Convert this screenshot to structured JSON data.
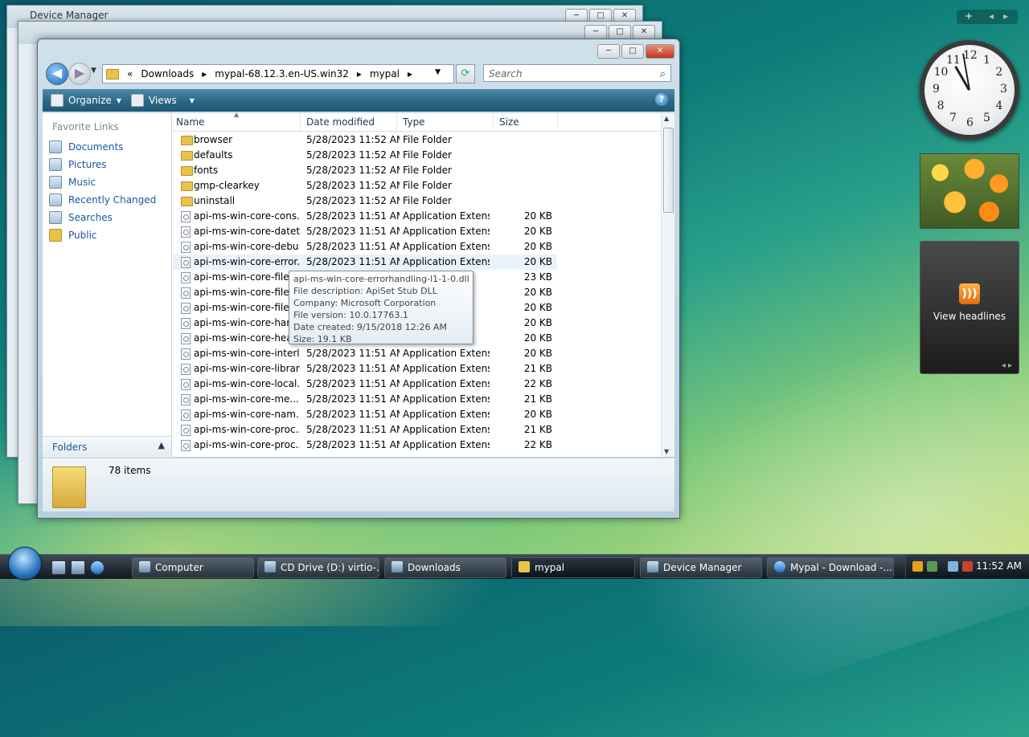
{
  "background_windows": [
    {
      "title": "Device Manager"
    },
    {
      "title": ""
    }
  ],
  "window_controls": {
    "minimize": "─",
    "maximize": "□",
    "close": "✕"
  },
  "address": {
    "prefix": "«",
    "crumbs": [
      "Downloads",
      "mypal-68.12.3.en-US.win32",
      "mypal"
    ],
    "separator": "▸",
    "search_placeholder": "Search"
  },
  "toolbar": {
    "organize": "Organize",
    "views": "Views",
    "help": "?"
  },
  "nav": {
    "heading": "Favorite Links",
    "items": [
      "Documents",
      "Pictures",
      "Music",
      "Recently Changed",
      "Searches",
      "Public"
    ],
    "folders_label": "Folders"
  },
  "columns": {
    "name": "Name",
    "date": "Date modified",
    "type": "Type",
    "size": "Size"
  },
  "files": [
    {
      "name": "browser",
      "date": "5/28/2023 11:52 AM",
      "type": "File Folder",
      "size": "",
      "kind": "folder"
    },
    {
      "name": "defaults",
      "date": "5/28/2023 11:52 AM",
      "type": "File Folder",
      "size": "",
      "kind": "folder"
    },
    {
      "name": "fonts",
      "date": "5/28/2023 11:52 AM",
      "type": "File Folder",
      "size": "",
      "kind": "folder"
    },
    {
      "name": "gmp-clearkey",
      "date": "5/28/2023 11:52 AM",
      "type": "File Folder",
      "size": "",
      "kind": "folder"
    },
    {
      "name": "uninstall",
      "date": "5/28/2023 11:52 AM",
      "type": "File Folder",
      "size": "",
      "kind": "folder"
    },
    {
      "name": "api-ms-win-core-cons...",
      "date": "5/28/2023 11:51 AM",
      "type": "Application Extens...",
      "size": "20 KB",
      "kind": "dll"
    },
    {
      "name": "api-ms-win-core-datet...",
      "date": "5/28/2023 11:51 AM",
      "type": "Application Extens...",
      "size": "20 KB",
      "kind": "dll"
    },
    {
      "name": "api-ms-win-core-debu...",
      "date": "5/28/2023 11:51 AM",
      "type": "Application Extens...",
      "size": "20 KB",
      "kind": "dll"
    },
    {
      "name": "api-ms-win-core-error...",
      "date": "5/28/2023 11:51 AM",
      "type": "Application Extens...",
      "size": "20 KB",
      "kind": "dll"
    },
    {
      "name": "api-ms-win-core-file-l",
      "date": "",
      "type": "ns...",
      "size": "23 KB",
      "kind": "dll"
    },
    {
      "name": "api-ms-win-core-file-l",
      "date": "",
      "type": "ns...",
      "size": "20 KB",
      "kind": "dll"
    },
    {
      "name": "api-ms-win-core-file-l",
      "date": "",
      "type": "ns...",
      "size": "20 KB",
      "kind": "dll"
    },
    {
      "name": "api-ms-win-core-hand",
      "date": "",
      "type": "ns...",
      "size": "20 KB",
      "kind": "dll"
    },
    {
      "name": "api-ms-win-core-heap",
      "date": "",
      "type": "ns...",
      "size": "20 KB",
      "kind": "dll"
    },
    {
      "name": "api-ms-win-core-interl...",
      "date": "5/28/2023 11:51 AM",
      "type": "Application Extens...",
      "size": "20 KB",
      "kind": "dll"
    },
    {
      "name": "api-ms-win-core-librar...",
      "date": "5/28/2023 11:51 AM",
      "type": "Application Extens...",
      "size": "21 KB",
      "kind": "dll"
    },
    {
      "name": "api-ms-win-core-local...",
      "date": "5/28/2023 11:51 AM",
      "type": "Application Extens...",
      "size": "22 KB",
      "kind": "dll"
    },
    {
      "name": "api-ms-win-core-me...",
      "date": "5/28/2023 11:51 AM",
      "type": "Application Extens...",
      "size": "21 KB",
      "kind": "dll"
    },
    {
      "name": "api-ms-win-core-nam...",
      "date": "5/28/2023 11:51 AM",
      "type": "Application Extens...",
      "size": "20 KB",
      "kind": "dll"
    },
    {
      "name": "api-ms-win-core-proc...",
      "date": "5/28/2023 11:51 AM",
      "type": "Application Extens...",
      "size": "21 KB",
      "kind": "dll"
    },
    {
      "name": "api-ms-win-core-proc...",
      "date": "5/28/2023 11:51 AM",
      "type": "Application Extens...",
      "size": "22 KB",
      "kind": "dll"
    }
  ],
  "tooltip": {
    "lines": [
      "api-ms-win-core-errorhandling-l1-1-0.dll",
      "File description: ApiSet Stub DLL",
      "Company: Microsoft Corporation",
      "File version: 10.0.17763.1",
      "Date created: 9/15/2018 12:26 AM",
      "Size: 19.1 KB"
    ]
  },
  "details": {
    "count": "78 items"
  },
  "gadgets": {
    "bar_add": "+",
    "bar_prev": "◂",
    "bar_next": "▸",
    "clock_numbers": [
      "12",
      "1",
      "2",
      "3",
      "4",
      "5",
      "6",
      "7",
      "8",
      "9",
      "10",
      "11"
    ],
    "feed_label": "View headlines",
    "feed_nav": "◂  ▸"
  },
  "taskbar": {
    "buttons": [
      "Computer",
      "CD Drive (D:) virtio-...",
      "Downloads",
      "mypal",
      "Device Manager",
      "Mypal - Download -..."
    ],
    "time": "11:52 AM"
  },
  "colors": {
    "link_blue": "#1a56a0",
    "toolbar_teal": "#2b6784",
    "folder_yellow": "#e9c24a"
  }
}
